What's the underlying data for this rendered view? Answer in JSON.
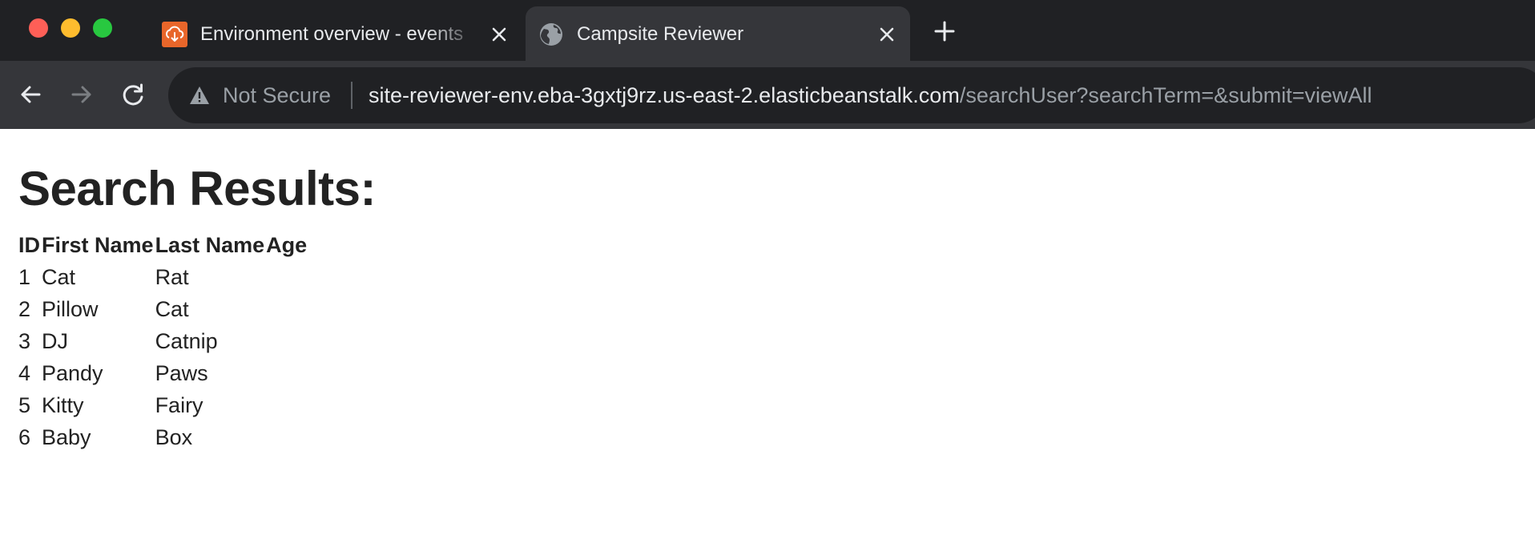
{
  "browser": {
    "tabs": [
      {
        "title": "Environment overview - events",
        "favicon": "aws-elastic-beanstalk-icon",
        "active": false
      },
      {
        "title": "Campsite Reviewer",
        "favicon": "globe-icon",
        "active": true
      }
    ],
    "address_bar": {
      "security_label": "Not Secure",
      "url_host": "site-reviewer-env.eba-3gxtj9rz.us-east-2.elasticbeanstalk.com",
      "url_path": "/searchUser?searchTerm=&submit=viewAll"
    }
  },
  "page": {
    "heading": "Search Results:",
    "table": {
      "columns": [
        "ID",
        "First Name",
        "Last Name",
        "Age"
      ],
      "rows": [
        {
          "id": "1",
          "first": "Cat",
          "last": "Rat",
          "age": ""
        },
        {
          "id": "2",
          "first": "Pillow",
          "last": "Cat",
          "age": ""
        },
        {
          "id": "3",
          "first": "DJ",
          "last": "Catnip",
          "age": ""
        },
        {
          "id": "4",
          "first": "Pandy",
          "last": "Paws",
          "age": ""
        },
        {
          "id": "5",
          "first": "Kitty",
          "last": "Fairy",
          "age": ""
        },
        {
          "id": "6",
          "first": "Baby",
          "last": "Box",
          "age": ""
        }
      ]
    }
  },
  "colors": {
    "chrome_dark": "#202124",
    "chrome_toolbar": "#35363a",
    "close_red": "#fe5f57",
    "minimize_yellow": "#febc2e",
    "zoom_green": "#28c840",
    "aws_orange": "#e8662a"
  }
}
